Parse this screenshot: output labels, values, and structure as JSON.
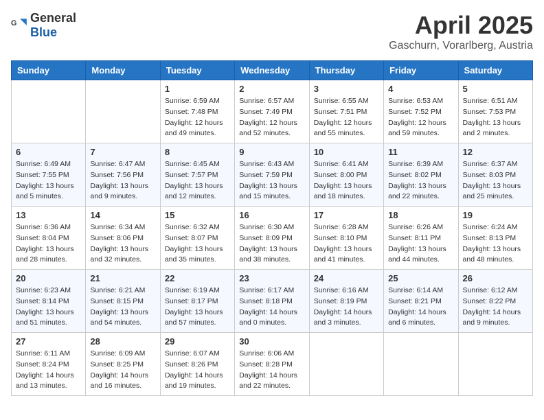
{
  "header": {
    "logo_general": "General",
    "logo_blue": "Blue",
    "month_title": "April 2025",
    "location": "Gaschurn, Vorarlberg, Austria"
  },
  "days_of_week": [
    "Sunday",
    "Monday",
    "Tuesday",
    "Wednesday",
    "Thursday",
    "Friday",
    "Saturday"
  ],
  "weeks": [
    [
      {
        "day": "",
        "info": ""
      },
      {
        "day": "",
        "info": ""
      },
      {
        "day": "1",
        "info": "Sunrise: 6:59 AM\nSunset: 7:48 PM\nDaylight: 12 hours and 49 minutes."
      },
      {
        "day": "2",
        "info": "Sunrise: 6:57 AM\nSunset: 7:49 PM\nDaylight: 12 hours and 52 minutes."
      },
      {
        "day": "3",
        "info": "Sunrise: 6:55 AM\nSunset: 7:51 PM\nDaylight: 12 hours and 55 minutes."
      },
      {
        "day": "4",
        "info": "Sunrise: 6:53 AM\nSunset: 7:52 PM\nDaylight: 12 hours and 59 minutes."
      },
      {
        "day": "5",
        "info": "Sunrise: 6:51 AM\nSunset: 7:53 PM\nDaylight: 13 hours and 2 minutes."
      }
    ],
    [
      {
        "day": "6",
        "info": "Sunrise: 6:49 AM\nSunset: 7:55 PM\nDaylight: 13 hours and 5 minutes."
      },
      {
        "day": "7",
        "info": "Sunrise: 6:47 AM\nSunset: 7:56 PM\nDaylight: 13 hours and 9 minutes."
      },
      {
        "day": "8",
        "info": "Sunrise: 6:45 AM\nSunset: 7:57 PM\nDaylight: 13 hours and 12 minutes."
      },
      {
        "day": "9",
        "info": "Sunrise: 6:43 AM\nSunset: 7:59 PM\nDaylight: 13 hours and 15 minutes."
      },
      {
        "day": "10",
        "info": "Sunrise: 6:41 AM\nSunset: 8:00 PM\nDaylight: 13 hours and 18 minutes."
      },
      {
        "day": "11",
        "info": "Sunrise: 6:39 AM\nSunset: 8:02 PM\nDaylight: 13 hours and 22 minutes."
      },
      {
        "day": "12",
        "info": "Sunrise: 6:37 AM\nSunset: 8:03 PM\nDaylight: 13 hours and 25 minutes."
      }
    ],
    [
      {
        "day": "13",
        "info": "Sunrise: 6:36 AM\nSunset: 8:04 PM\nDaylight: 13 hours and 28 minutes."
      },
      {
        "day": "14",
        "info": "Sunrise: 6:34 AM\nSunset: 8:06 PM\nDaylight: 13 hours and 32 minutes."
      },
      {
        "day": "15",
        "info": "Sunrise: 6:32 AM\nSunset: 8:07 PM\nDaylight: 13 hours and 35 minutes."
      },
      {
        "day": "16",
        "info": "Sunrise: 6:30 AM\nSunset: 8:09 PM\nDaylight: 13 hours and 38 minutes."
      },
      {
        "day": "17",
        "info": "Sunrise: 6:28 AM\nSunset: 8:10 PM\nDaylight: 13 hours and 41 minutes."
      },
      {
        "day": "18",
        "info": "Sunrise: 6:26 AM\nSunset: 8:11 PM\nDaylight: 13 hours and 44 minutes."
      },
      {
        "day": "19",
        "info": "Sunrise: 6:24 AM\nSunset: 8:13 PM\nDaylight: 13 hours and 48 minutes."
      }
    ],
    [
      {
        "day": "20",
        "info": "Sunrise: 6:23 AM\nSunset: 8:14 PM\nDaylight: 13 hours and 51 minutes."
      },
      {
        "day": "21",
        "info": "Sunrise: 6:21 AM\nSunset: 8:15 PM\nDaylight: 13 hours and 54 minutes."
      },
      {
        "day": "22",
        "info": "Sunrise: 6:19 AM\nSunset: 8:17 PM\nDaylight: 13 hours and 57 minutes."
      },
      {
        "day": "23",
        "info": "Sunrise: 6:17 AM\nSunset: 8:18 PM\nDaylight: 14 hours and 0 minutes."
      },
      {
        "day": "24",
        "info": "Sunrise: 6:16 AM\nSunset: 8:19 PM\nDaylight: 14 hours and 3 minutes."
      },
      {
        "day": "25",
        "info": "Sunrise: 6:14 AM\nSunset: 8:21 PM\nDaylight: 14 hours and 6 minutes."
      },
      {
        "day": "26",
        "info": "Sunrise: 6:12 AM\nSunset: 8:22 PM\nDaylight: 14 hours and 9 minutes."
      }
    ],
    [
      {
        "day": "27",
        "info": "Sunrise: 6:11 AM\nSunset: 8:24 PM\nDaylight: 14 hours and 13 minutes."
      },
      {
        "day": "28",
        "info": "Sunrise: 6:09 AM\nSunset: 8:25 PM\nDaylight: 14 hours and 16 minutes."
      },
      {
        "day": "29",
        "info": "Sunrise: 6:07 AM\nSunset: 8:26 PM\nDaylight: 14 hours and 19 minutes."
      },
      {
        "day": "30",
        "info": "Sunrise: 6:06 AM\nSunset: 8:28 PM\nDaylight: 14 hours and 22 minutes."
      },
      {
        "day": "",
        "info": ""
      },
      {
        "day": "",
        "info": ""
      },
      {
        "day": "",
        "info": ""
      }
    ]
  ]
}
